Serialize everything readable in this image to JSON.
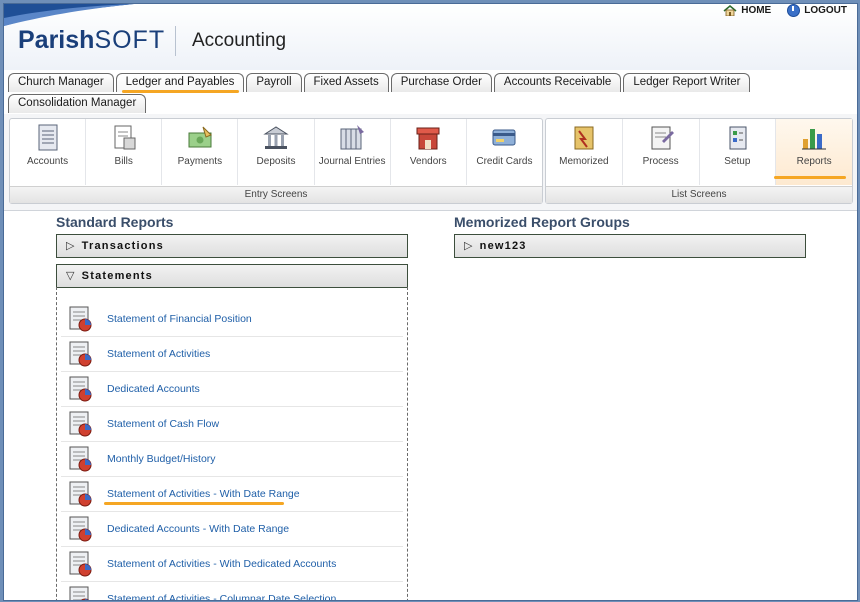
{
  "header": {
    "logo": {
      "part1": "Parish",
      "part2": "SOFT"
    },
    "app_title": "Accounting",
    "links": [
      {
        "label": "HOME",
        "icon": "home-icon"
      },
      {
        "label": "LOGOUT",
        "icon": "logout-icon"
      }
    ]
  },
  "tabs": {
    "row1": [
      "Church Manager",
      "Ledger and Payables",
      "Payroll",
      "Fixed Assets",
      "Purchase Order",
      "Accounts Receivable",
      "Ledger Report Writer"
    ],
    "row2": [
      "Consolidation Manager"
    ],
    "active": "Ledger and Payables"
  },
  "toolbar": {
    "entry": {
      "caption": "Entry Screens",
      "items": [
        {
          "label": "Accounts",
          "icon": "accounts-icon"
        },
        {
          "label": "Bills",
          "icon": "bills-icon"
        },
        {
          "label": "Payments",
          "icon": "payments-icon"
        },
        {
          "label": "Deposits",
          "icon": "deposits-icon"
        },
        {
          "label": "Journal Entries",
          "icon": "journal-entries-icon"
        },
        {
          "label": "Vendors",
          "icon": "vendors-icon"
        },
        {
          "label": "Credit Cards",
          "icon": "credit-cards-icon"
        }
      ]
    },
    "list": {
      "caption": "List Screens",
      "items": [
        {
          "label": "Memorized",
          "icon": "memorized-icon"
        },
        {
          "label": "Process",
          "icon": "process-icon"
        },
        {
          "label": "Setup",
          "icon": "setup-icon"
        },
        {
          "label": "Reports",
          "icon": "reports-icon"
        }
      ]
    },
    "selected": "Reports"
  },
  "standard_reports": {
    "title": "Standard Reports",
    "sections": [
      {
        "label": "Transactions",
        "expanded": false
      },
      {
        "label": "Statements",
        "expanded": true
      }
    ],
    "statements": [
      "Statement of Financial Position",
      "Statement of Activities",
      "Dedicated Accounts",
      "Statement of Cash Flow",
      "Monthly Budget/History",
      "Statement of Activities - With Date Range",
      "Dedicated Accounts - With Date Range",
      "Statement of Activities - With Dedicated Accounts",
      "Statement of Activities - Columnar Date Selection"
    ],
    "highlighted": "Statement of Activities - With Date Range"
  },
  "memorized_groups": {
    "title": "Memorized Report Groups",
    "sections": [
      {
        "label": "new123",
        "expanded": false
      }
    ]
  },
  "colors": {
    "accent": "#f5a623",
    "link": "#1f5fa8",
    "title": "#3a4e6a",
    "brand": "#1a3f7a"
  }
}
